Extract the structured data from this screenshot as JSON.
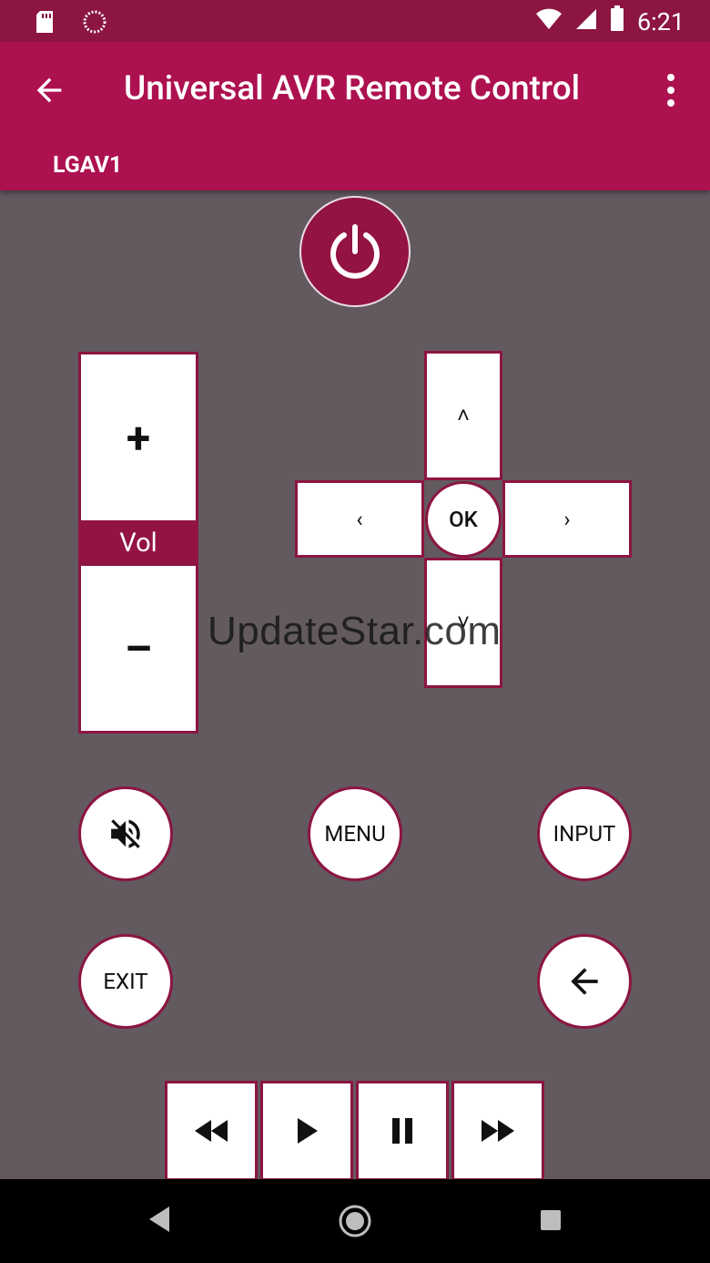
{
  "status_bar": {
    "time": "6:21",
    "icons": [
      "sd-card-icon",
      "loading-icon",
      "wifi-icon",
      "signal-icon",
      "battery-icon"
    ]
  },
  "app_bar": {
    "title": "Universal AVR Remote Control",
    "back_icon": "arrow-back-icon",
    "menu_icon": "overflow-menu-icon"
  },
  "device": {
    "name": "LGAV1"
  },
  "remote": {
    "power_icon": "power-icon",
    "volume": {
      "plus": "+",
      "label": "Vol",
      "minus": "–"
    },
    "dpad": {
      "up": "˄",
      "down": "˅",
      "left": "‹",
      "right": "›",
      "ok": "OK"
    },
    "buttons": {
      "mute_icon": "mute-icon",
      "menu": "MENU",
      "input": "INPUT",
      "exit": "EXIT",
      "back_icon": "back-arrow-icon"
    },
    "media": [
      "rewind-icon",
      "play-icon",
      "pause-icon",
      "fast-forward-icon"
    ]
  },
  "watermark": "UpdateStar.com",
  "colors": {
    "primary": "#ad1150",
    "primary_dark": "#8c1542",
    "accent": "#931343",
    "background": "#625a5f"
  }
}
